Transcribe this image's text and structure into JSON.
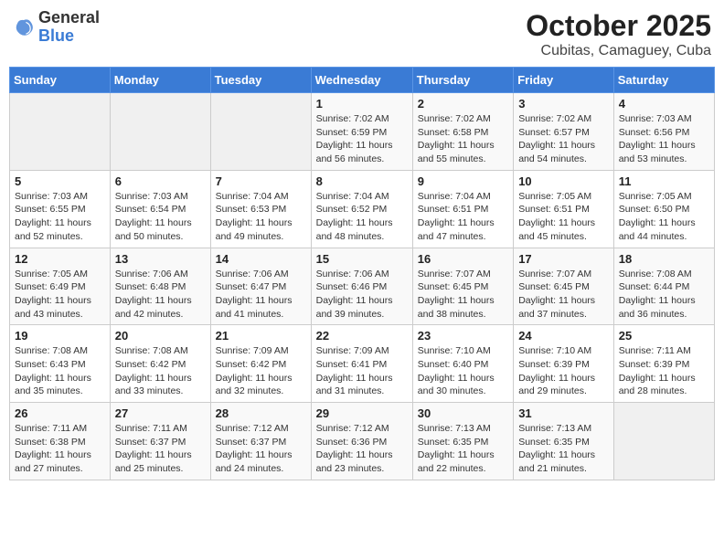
{
  "header": {
    "logo_general": "General",
    "logo_blue": "Blue",
    "title": "October 2025",
    "location": "Cubitas, Camaguey, Cuba"
  },
  "weekdays": [
    "Sunday",
    "Monday",
    "Tuesday",
    "Wednesday",
    "Thursday",
    "Friday",
    "Saturday"
  ],
  "weeks": [
    [
      {
        "day": "",
        "sunrise": "",
        "sunset": "",
        "daylight": "",
        "empty": true
      },
      {
        "day": "",
        "sunrise": "",
        "sunset": "",
        "daylight": "",
        "empty": true
      },
      {
        "day": "",
        "sunrise": "",
        "sunset": "",
        "daylight": "",
        "empty": true
      },
      {
        "day": "1",
        "sunrise": "Sunrise: 7:02 AM",
        "sunset": "Sunset: 6:59 PM",
        "daylight": "Daylight: 11 hours and 56 minutes."
      },
      {
        "day": "2",
        "sunrise": "Sunrise: 7:02 AM",
        "sunset": "Sunset: 6:58 PM",
        "daylight": "Daylight: 11 hours and 55 minutes."
      },
      {
        "day": "3",
        "sunrise": "Sunrise: 7:02 AM",
        "sunset": "Sunset: 6:57 PM",
        "daylight": "Daylight: 11 hours and 54 minutes."
      },
      {
        "day": "4",
        "sunrise": "Sunrise: 7:03 AM",
        "sunset": "Sunset: 6:56 PM",
        "daylight": "Daylight: 11 hours and 53 minutes."
      }
    ],
    [
      {
        "day": "5",
        "sunrise": "Sunrise: 7:03 AM",
        "sunset": "Sunset: 6:55 PM",
        "daylight": "Daylight: 11 hours and 52 minutes."
      },
      {
        "day": "6",
        "sunrise": "Sunrise: 7:03 AM",
        "sunset": "Sunset: 6:54 PM",
        "daylight": "Daylight: 11 hours and 50 minutes."
      },
      {
        "day": "7",
        "sunrise": "Sunrise: 7:04 AM",
        "sunset": "Sunset: 6:53 PM",
        "daylight": "Daylight: 11 hours and 49 minutes."
      },
      {
        "day": "8",
        "sunrise": "Sunrise: 7:04 AM",
        "sunset": "Sunset: 6:52 PM",
        "daylight": "Daylight: 11 hours and 48 minutes."
      },
      {
        "day": "9",
        "sunrise": "Sunrise: 7:04 AM",
        "sunset": "Sunset: 6:51 PM",
        "daylight": "Daylight: 11 hours and 47 minutes."
      },
      {
        "day": "10",
        "sunrise": "Sunrise: 7:05 AM",
        "sunset": "Sunset: 6:51 PM",
        "daylight": "Daylight: 11 hours and 45 minutes."
      },
      {
        "day": "11",
        "sunrise": "Sunrise: 7:05 AM",
        "sunset": "Sunset: 6:50 PM",
        "daylight": "Daylight: 11 hours and 44 minutes."
      }
    ],
    [
      {
        "day": "12",
        "sunrise": "Sunrise: 7:05 AM",
        "sunset": "Sunset: 6:49 PM",
        "daylight": "Daylight: 11 hours and 43 minutes."
      },
      {
        "day": "13",
        "sunrise": "Sunrise: 7:06 AM",
        "sunset": "Sunset: 6:48 PM",
        "daylight": "Daylight: 11 hours and 42 minutes."
      },
      {
        "day": "14",
        "sunrise": "Sunrise: 7:06 AM",
        "sunset": "Sunset: 6:47 PM",
        "daylight": "Daylight: 11 hours and 41 minutes."
      },
      {
        "day": "15",
        "sunrise": "Sunrise: 7:06 AM",
        "sunset": "Sunset: 6:46 PM",
        "daylight": "Daylight: 11 hours and 39 minutes."
      },
      {
        "day": "16",
        "sunrise": "Sunrise: 7:07 AM",
        "sunset": "Sunset: 6:45 PM",
        "daylight": "Daylight: 11 hours and 38 minutes."
      },
      {
        "day": "17",
        "sunrise": "Sunrise: 7:07 AM",
        "sunset": "Sunset: 6:45 PM",
        "daylight": "Daylight: 11 hours and 37 minutes."
      },
      {
        "day": "18",
        "sunrise": "Sunrise: 7:08 AM",
        "sunset": "Sunset: 6:44 PM",
        "daylight": "Daylight: 11 hours and 36 minutes."
      }
    ],
    [
      {
        "day": "19",
        "sunrise": "Sunrise: 7:08 AM",
        "sunset": "Sunset: 6:43 PM",
        "daylight": "Daylight: 11 hours and 35 minutes."
      },
      {
        "day": "20",
        "sunrise": "Sunrise: 7:08 AM",
        "sunset": "Sunset: 6:42 PM",
        "daylight": "Daylight: 11 hours and 33 minutes."
      },
      {
        "day": "21",
        "sunrise": "Sunrise: 7:09 AM",
        "sunset": "Sunset: 6:42 PM",
        "daylight": "Daylight: 11 hours and 32 minutes."
      },
      {
        "day": "22",
        "sunrise": "Sunrise: 7:09 AM",
        "sunset": "Sunset: 6:41 PM",
        "daylight": "Daylight: 11 hours and 31 minutes."
      },
      {
        "day": "23",
        "sunrise": "Sunrise: 7:10 AM",
        "sunset": "Sunset: 6:40 PM",
        "daylight": "Daylight: 11 hours and 30 minutes."
      },
      {
        "day": "24",
        "sunrise": "Sunrise: 7:10 AM",
        "sunset": "Sunset: 6:39 PM",
        "daylight": "Daylight: 11 hours and 29 minutes."
      },
      {
        "day": "25",
        "sunrise": "Sunrise: 7:11 AM",
        "sunset": "Sunset: 6:39 PM",
        "daylight": "Daylight: 11 hours and 28 minutes."
      }
    ],
    [
      {
        "day": "26",
        "sunrise": "Sunrise: 7:11 AM",
        "sunset": "Sunset: 6:38 PM",
        "daylight": "Daylight: 11 hours and 27 minutes."
      },
      {
        "day": "27",
        "sunrise": "Sunrise: 7:11 AM",
        "sunset": "Sunset: 6:37 PM",
        "daylight": "Daylight: 11 hours and 25 minutes."
      },
      {
        "day": "28",
        "sunrise": "Sunrise: 7:12 AM",
        "sunset": "Sunset: 6:37 PM",
        "daylight": "Daylight: 11 hours and 24 minutes."
      },
      {
        "day": "29",
        "sunrise": "Sunrise: 7:12 AM",
        "sunset": "Sunset: 6:36 PM",
        "daylight": "Daylight: 11 hours and 23 minutes."
      },
      {
        "day": "30",
        "sunrise": "Sunrise: 7:13 AM",
        "sunset": "Sunset: 6:35 PM",
        "daylight": "Daylight: 11 hours and 22 minutes."
      },
      {
        "day": "31",
        "sunrise": "Sunrise: 7:13 AM",
        "sunset": "Sunset: 6:35 PM",
        "daylight": "Daylight: 11 hours and 21 minutes."
      },
      {
        "day": "",
        "sunrise": "",
        "sunset": "",
        "daylight": "",
        "empty": true
      }
    ]
  ]
}
